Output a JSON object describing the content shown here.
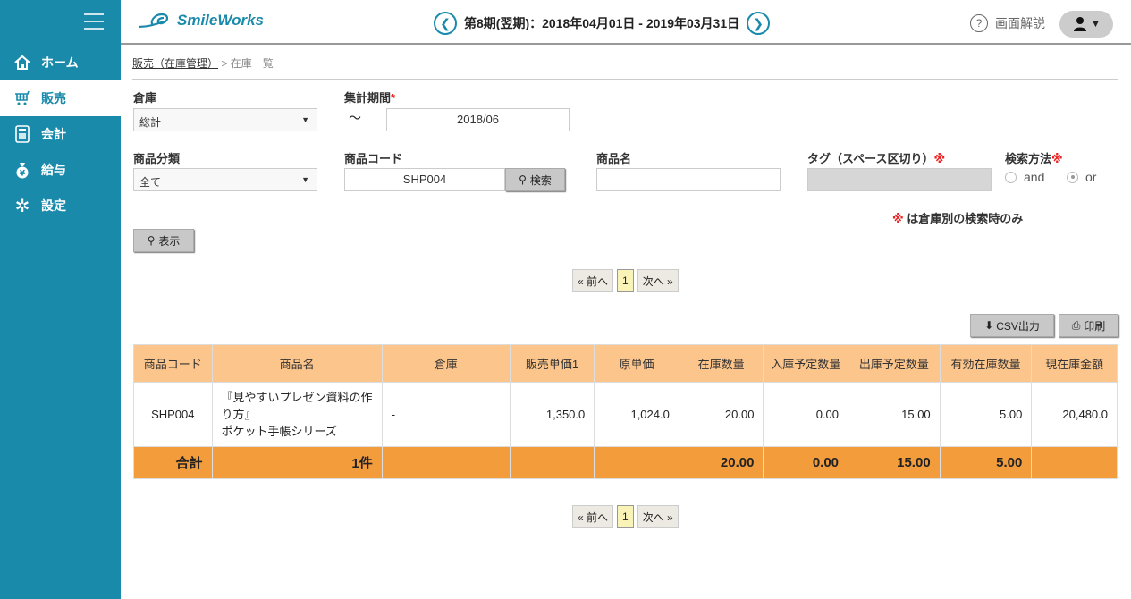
{
  "sidebar": {
    "items": [
      {
        "label": "ホーム",
        "icon": "home-icon",
        "active": false
      },
      {
        "label": "販売",
        "icon": "cart-icon",
        "active": true
      },
      {
        "label": "会計",
        "icon": "calculator-icon",
        "active": false
      },
      {
        "label": "給与",
        "icon": "money-bag-icon",
        "active": false
      },
      {
        "label": "設定",
        "icon": "gear-icon",
        "active": false
      }
    ]
  },
  "header": {
    "logo": "SmileWorks",
    "period": "第8期(翌期)：2018年04月01日 - 2019年03月31日",
    "help": "画面解説"
  },
  "breadcrumb": {
    "parent": "販売（在庫管理）",
    "sep": ">",
    "current": "在庫一覧"
  },
  "form": {
    "warehouse_label": "倉庫",
    "warehouse_value": "総計",
    "period_label": "集計期間",
    "period_required": "*",
    "period_tilde": "〜",
    "period_value": "2018/06",
    "category_label": "商品分類",
    "category_value": "全て",
    "code_label": "商品コード",
    "code_value": "SHP004",
    "search_btn": "検索",
    "name_label": "商品名",
    "name_value": "",
    "tag_label": "タグ（スペース区切り）",
    "tag_mark": "※",
    "method_label": "検索方法",
    "method_mark": "※",
    "method_options": [
      "and",
      "or"
    ],
    "method_selected": "or",
    "note_mark": "※",
    "note": " は倉庫別の検索時のみ",
    "show_btn": "表示"
  },
  "pager": {
    "prev": "« 前へ",
    "page": "1",
    "next": "次へ »"
  },
  "actions": {
    "csv": "CSV出力",
    "print": "印刷"
  },
  "table": {
    "headers": [
      "商品コード",
      "商品名",
      "倉庫",
      "販売単価1",
      "原単価",
      "在庫数量",
      "入庫予定数量",
      "出庫予定数量",
      "有効在庫数量",
      "現在庫金額"
    ],
    "rows": [
      {
        "code": "SHP004",
        "name1": "『見やすいプレゼン資料の作",
        "name2": "り方』",
        "name3": "ポケット手帳シリーズ",
        "warehouse": "-",
        "price": "1,350.0",
        "cost": "1,024.0",
        "stock": "20.00",
        "incoming": "0.00",
        "outgoing": "15.00",
        "available": "5.00",
        "amount": "20,480.0"
      }
    ],
    "total": {
      "label": "合計",
      "count": "1件",
      "stock": "20.00",
      "incoming": "0.00",
      "outgoing": "15.00",
      "available": "5.00"
    }
  },
  "colors": {
    "brand": "#1a8aab",
    "header_row": "#fcc58b",
    "total_row": "#f39c3c"
  }
}
